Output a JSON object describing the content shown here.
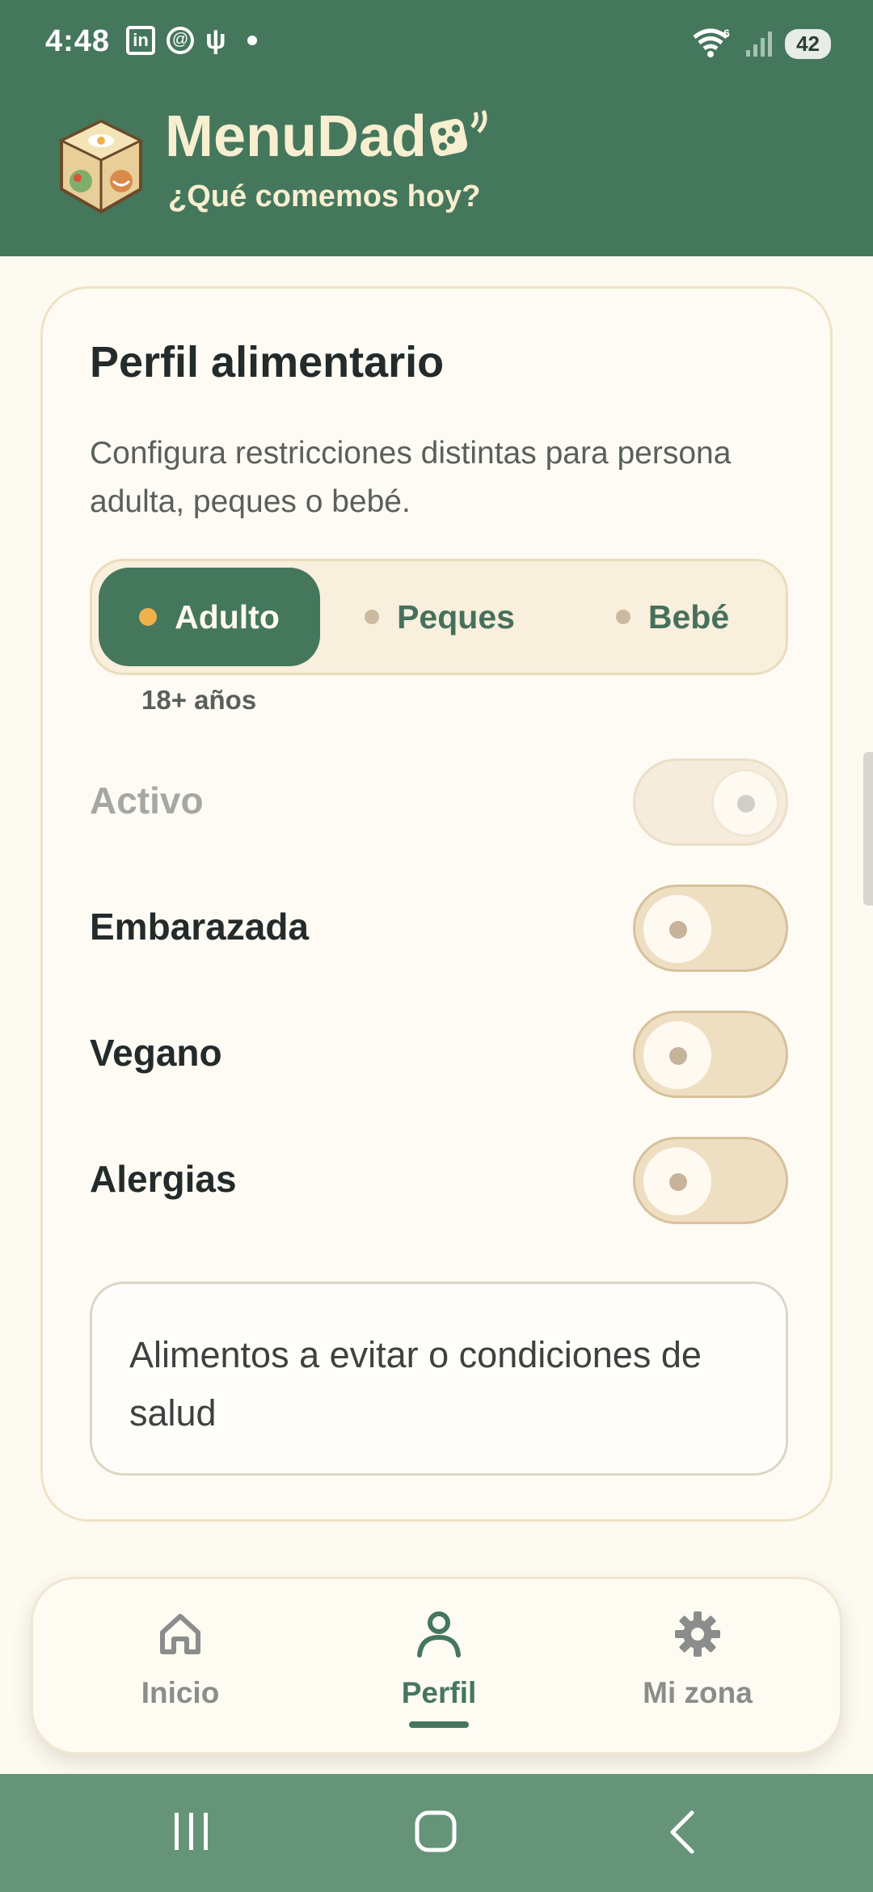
{
  "status_bar": {
    "time": "4:48",
    "notification_icons": [
      "linkedin-icon",
      "threads-icon",
      "usb-icon",
      "dot-icon"
    ],
    "wifi_badge": "6",
    "battery": "42"
  },
  "header": {
    "title": "MenuDado",
    "title_text": "MenuDad",
    "subtitle": "¿Qué comemos hoy?",
    "bg_color": "#45775d",
    "text_color": "#f7efd0"
  },
  "profile": {
    "title": "Perfil alimentario",
    "description": "Configura restricciones distintas para persona adulta, peques o bebé.",
    "tabs": [
      {
        "label": "Adulto",
        "active": true
      },
      {
        "label": "Peques",
        "active": false
      },
      {
        "label": "Bebé",
        "active": false
      }
    ],
    "age_hint": "18+ años",
    "options": [
      {
        "label": "Activo",
        "state": "disabled"
      },
      {
        "label": "Embarazada",
        "state": "off"
      },
      {
        "label": "Vegano",
        "state": "off"
      },
      {
        "label": "Alergias",
        "state": "off"
      }
    ],
    "textarea_placeholder": "Alimentos a evitar o condiciones de salud"
  },
  "bottom_nav": {
    "items": [
      {
        "label": "Inicio",
        "icon": "home-icon",
        "active": false
      },
      {
        "label": "Perfil",
        "icon": "person-icon",
        "active": true
      },
      {
        "label": "Mi zona",
        "icon": "gear-icon",
        "active": false
      }
    ]
  },
  "system_nav": [
    "recents-button",
    "home-button",
    "back-button"
  ],
  "colors": {
    "accent": "#45775d",
    "active_dot": "#f0b14a",
    "background": "#fdfaf1"
  }
}
